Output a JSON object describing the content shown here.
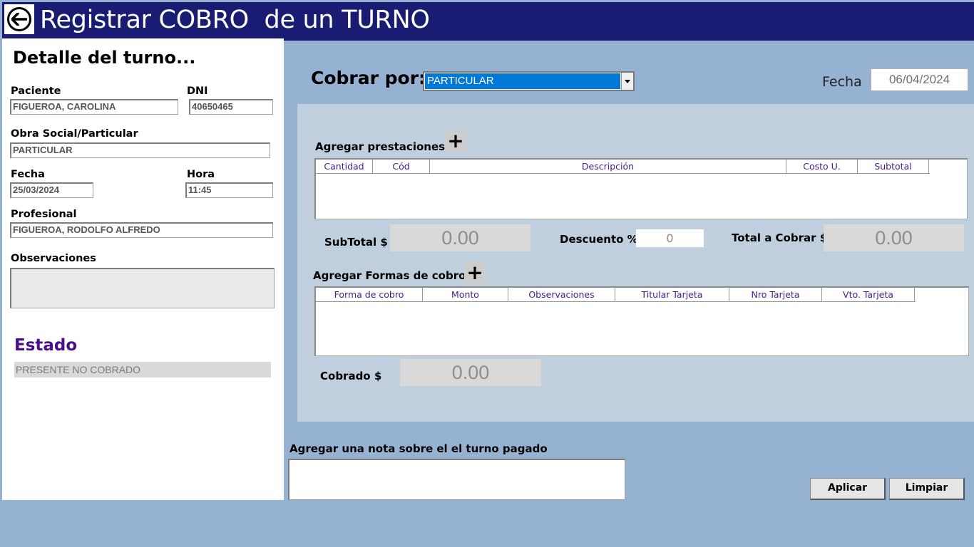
{
  "header": {
    "title": "Registrar COBRO  de un TURNO",
    "back_icon": "back-arrow-icon"
  },
  "detail": {
    "heading": "Detalle del turno...",
    "paciente_label": "Paciente",
    "paciente_value": "FIGUEROA, CAROLINA",
    "dni_label": "DNI",
    "dni_value": "40650465",
    "obra_social_label": "Obra Social/Particular",
    "obra_social_value": "PARTICULAR",
    "fecha_label": "Fecha",
    "fecha_value": "25/03/2024",
    "hora_label": "Hora",
    "hora_value": "11:45",
    "profesional_label": "Profesional",
    "profesional_value": "FIGUEROA, RODOLFO ALFREDO",
    "observaciones_label": "Observaciones",
    "observaciones_value": "",
    "estado_label": "Estado",
    "estado_value": "PRESENTE NO COBRADO"
  },
  "cobro": {
    "cobrar_por_label": "Cobrar por:",
    "cobrar_por_value": "PARTICULAR",
    "fecha_label": "Fecha",
    "fecha_value": "06/04/2024",
    "agregar_prestaciones_label": "Agregar prestaciones:",
    "prestaciones_columns": [
      "Cantidad",
      "Cód",
      "Descripción",
      "Costo U.",
      "Subtotal"
    ],
    "subtotal_label": "SubTotal $",
    "subtotal_value": "0.00",
    "descuento_label": "Descuento %",
    "descuento_value": "0",
    "total_label": "Total a Cobrar $",
    "total_value": "0.00",
    "agregar_formas_label": "Agregar Formas de cobros:",
    "formas_columns": [
      "Forma de cobro",
      "Monto",
      "Observaciones",
      "Titular Tarjeta",
      "Nro Tarjeta",
      "Vto. Tarjeta"
    ],
    "cobrado_label": "Cobrado $",
    "cobrado_value": "0.00",
    "plus_symbol": "+",
    "nota_label": "Agregar una nota sobre el  el turno pagado",
    "nota_value": "",
    "aplicar_label": "Aplicar",
    "limpiar_label": "Limpiar"
  },
  "colors": {
    "title_bar": "#1A1C74",
    "background": "#96B2D2",
    "inner_panel": "#C0CFDE",
    "estado": "#4B0E8C",
    "selection": "#0078D7",
    "column_header": "#4B1A8E"
  }
}
